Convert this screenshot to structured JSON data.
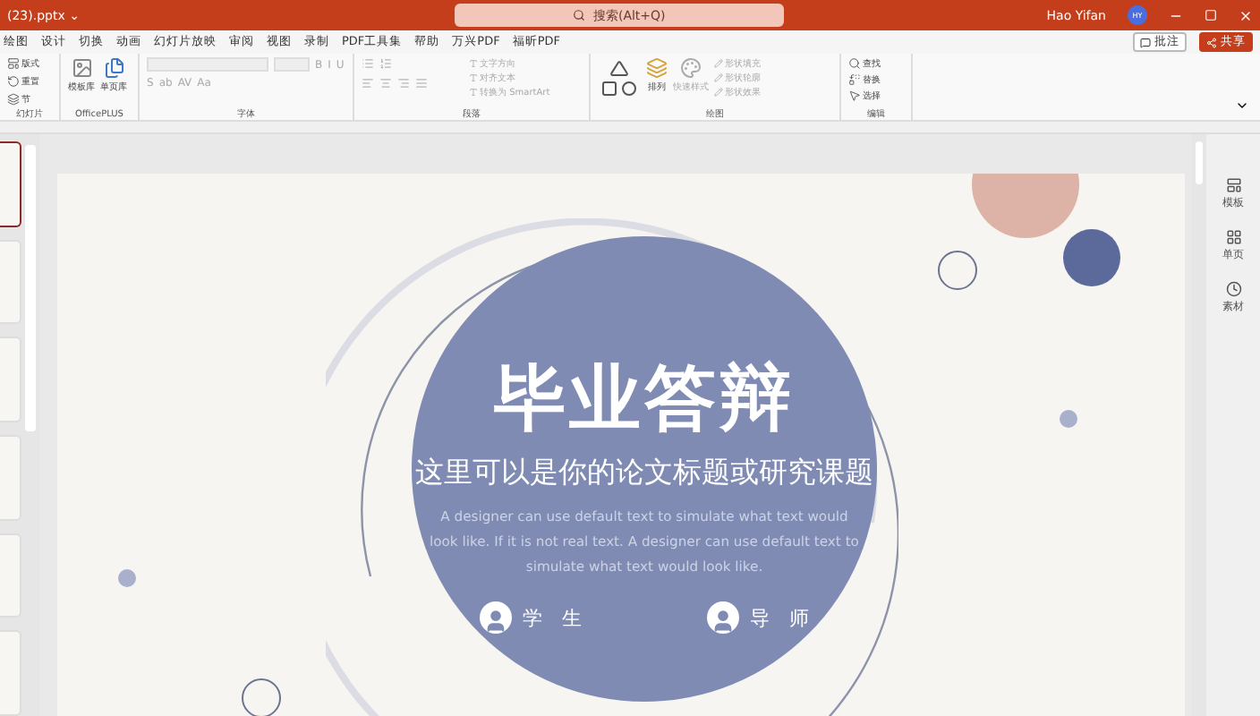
{
  "window": {
    "title": "(23).pptx ⌄",
    "search_placeholder": "搜索(Alt+Q)",
    "user": "Hao Yifan",
    "avatar": "HY"
  },
  "menu_tabs": [
    {
      "label": "绘图",
      "selected": false
    },
    {
      "label": "设计",
      "selected": false
    },
    {
      "label": "切换",
      "selected": false
    },
    {
      "label": "动画",
      "selected": false
    },
    {
      "label": "幻灯片放映",
      "selected": false
    },
    {
      "label": "审阅",
      "selected": false
    },
    {
      "label": "视图",
      "selected": false
    },
    {
      "label": "录制",
      "selected": false
    },
    {
      "label": "PDF工具集",
      "selected": false
    },
    {
      "label": "帮助",
      "selected": false
    },
    {
      "label": "万兴PDF",
      "selected": false
    },
    {
      "label": "福昕PDF",
      "selected": false
    }
  ],
  "comments_button": "批注",
  "share_button": "共享",
  "ribbon": {
    "groups": [
      {
        "kind": "slides",
        "label": "幻灯片",
        "items": [
          "版式",
          "重置",
          "节"
        ]
      },
      {
        "kind": "officeplus",
        "label": "OfficePLUS",
        "items": [
          "模板库",
          "单页库"
        ]
      },
      {
        "kind": "font",
        "label": "字体",
        "items": [
          "B",
          "I",
          "U",
          "S",
          "ab",
          "AV",
          "Aa"
        ]
      },
      {
        "kind": "paragraph",
        "label": "段落",
        "items": [
          "文字方向",
          "对齐文本",
          "转换为 SmartArt"
        ]
      },
      {
        "kind": "drawing",
        "label": "绘图",
        "items": [
          "排列",
          "快速样式",
          "形状填充",
          "形状轮廓",
          "形状效果"
        ]
      },
      {
        "kind": "editing",
        "label": "编辑",
        "items": [
          "查找",
          "替换",
          "选择"
        ]
      }
    ]
  },
  "thumbnails": [
    {
      "selected": true
    },
    {
      "selected": false
    },
    {
      "selected": false
    },
    {
      "selected": false
    },
    {
      "selected": false
    },
    {
      "selected": false
    }
  ],
  "slide": {
    "title": "毕业答辩",
    "subtitle": "这里可以是你的论文标题或研究课题",
    "body": "A designer can use default text to simulate what text would look like. If it is not real text. A designer can use default text to simulate what text would look like.",
    "people": [
      "学　生",
      "导　师"
    ]
  },
  "side_pane": [
    {
      "label": "模板"
    },
    {
      "label": "单页"
    },
    {
      "label": "素材"
    }
  ]
}
